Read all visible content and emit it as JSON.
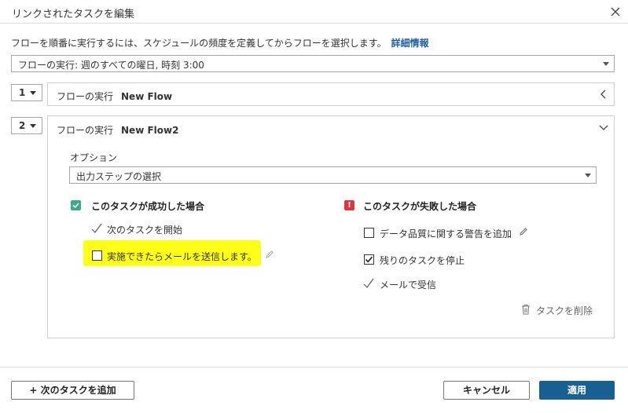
{
  "dialog": {
    "title": "リンクされたタスクを編集",
    "instruction": "フローを順番に実行するには、スケジュールの頻度を定義してからフローを選択します。",
    "more_info": "詳細情報",
    "schedule_value": "フローの実行: 週のすべての曜日, 時刻 3:00"
  },
  "steps": [
    {
      "number": "1",
      "prefix": "フローの実行",
      "flow": "New Flow"
    },
    {
      "number": "2",
      "prefix": "フローの実行",
      "flow": "New Flow2"
    }
  ],
  "options": {
    "label": "オプション",
    "value": "出力ステップの選択"
  },
  "success": {
    "heading": "このタスクが成功した場合",
    "start_next": "次のタスクを開始",
    "send_email": "実施できたらメールを送信します。",
    "send_email_checked": false
  },
  "failure": {
    "heading": "このタスクが失敗した場合",
    "badge": "!",
    "add_warning": "データ品質に関する警告を追加",
    "add_warning_checked": false,
    "stop_remaining": "残りのタスクを停止",
    "stop_remaining_checked": true,
    "receive_email": "メールで受信"
  },
  "delete_task": "タスクを削除",
  "footer": {
    "add_next": "+ 次のタスクを追加",
    "cancel": "キャンセル",
    "apply": "適用"
  },
  "colors": {
    "primary": "#1a5f91",
    "link": "#1f5f9e",
    "success_badge": "#3aa88a",
    "error_badge": "#d9363e",
    "highlight": "#ffff1a"
  }
}
